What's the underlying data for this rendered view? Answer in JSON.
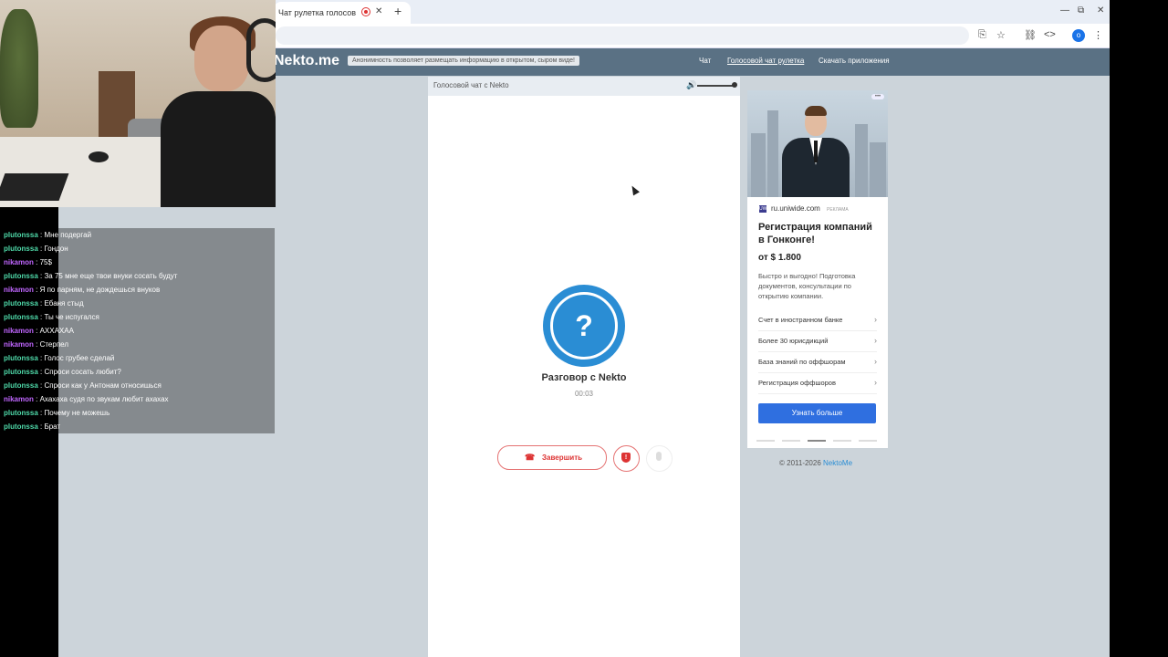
{
  "browser": {
    "tab_title": "Чат рулетка голосов",
    "tab_close": "✕",
    "new_tab": "+",
    "win_min": "—",
    "win_max": "⧉",
    "win_close": "✕"
  },
  "site": {
    "logo": "Nekto.me",
    "notice": "Анонимность позволяет размещать информацию в открытом, сыром виде!",
    "nav": [
      {
        "label": "Чат",
        "active": false
      },
      {
        "label": "Голосовой чат рулетка",
        "active": true
      },
      {
        "label": "Скачать приложения",
        "active": false
      }
    ]
  },
  "chat_panel": {
    "header": "Голосовой чат с Nekto",
    "volume_level": 1.0,
    "avatar_symbol": "?",
    "conversation_title": "Разговор с Nekto",
    "timer": "00:03",
    "end_label": "Завершить",
    "end_icon": "☎",
    "report_icon": "!"
  },
  "ad": {
    "favicon": "UW",
    "domain": "ru.uniwide.com",
    "tag": "РЕКЛАМА",
    "more": "•••",
    "headline": "Регистрация компаний в Гонконге!",
    "price": "от $ 1.800",
    "body": "Быстро и выгодно! Подготовка документов, консультации по открытию компании.",
    "links": [
      "Счет в иностранном банке",
      "Более 30 юрисдикций",
      "База знаний по оффшорам",
      "Регистрация оффшоров"
    ],
    "chevron": "›",
    "cta": "Узнать больше"
  },
  "footer": {
    "copyright": "© 2011-2026",
    "link": "NektoMe"
  },
  "stream_chat": {
    "separator": " : ",
    "colors": {
      "plutonssa": "#4ed8a8",
      "nikamon": "#c066ff"
    },
    "messages": [
      {
        "user": "plutonssa",
        "text": "Мне подергай"
      },
      {
        "user": "plutonssa",
        "text": "Гондон"
      },
      {
        "user": "nikamon",
        "text": "75$"
      },
      {
        "user": "plutonssa",
        "text": "За 75 мне еще твои внуки сосать будут"
      },
      {
        "user": "nikamon",
        "text": "Я по парням, не дождешься внуков"
      },
      {
        "user": "plutonssa",
        "text": "Ебаня стыд"
      },
      {
        "user": "plutonssa",
        "text": "Ты че испугался"
      },
      {
        "user": "nikamon",
        "text": "АХХАХАА"
      },
      {
        "user": "nikamon",
        "text": "Стерпел"
      },
      {
        "user": "plutonssa",
        "text": "Голос грубее сделай"
      },
      {
        "user": "plutonssa",
        "text": "Спроси сосать любит?"
      },
      {
        "user": "plutonssa",
        "text": "Спроси как у Антонам относишься"
      },
      {
        "user": "nikamon",
        "text": "Ахахаха судя по звукам любит ахахах"
      },
      {
        "user": "plutonssa",
        "text": "Почему не можешь"
      },
      {
        "user": "plutonssa",
        "text": "Брат"
      }
    ]
  }
}
